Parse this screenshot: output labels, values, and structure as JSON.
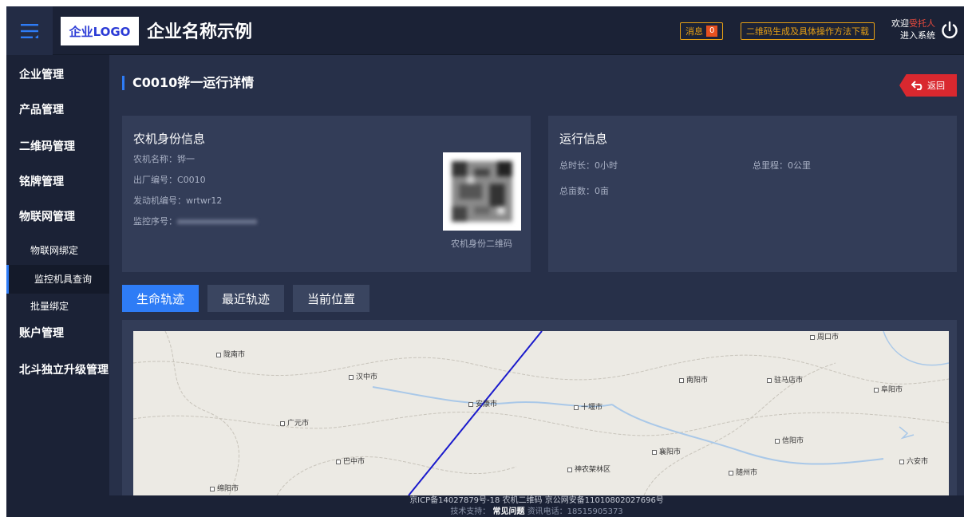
{
  "header": {
    "logo_text": "企业LOGO",
    "company_name": "企业名称示例",
    "messages_label": "消息",
    "messages_count": "0",
    "qr_download_label": "二维码生成及具体操作方法下载",
    "welcome_prefix": "欢迎",
    "welcome_user": "受托人",
    "welcome_suffix": "进入系统"
  },
  "sidebar": {
    "items": [
      {
        "label": "企业管理"
      },
      {
        "label": "产品管理"
      },
      {
        "label": "二维码管理"
      },
      {
        "label": "铭牌管理"
      },
      {
        "label": "物联网管理"
      },
      {
        "label": "账户管理"
      },
      {
        "label": "北斗独立升级管理"
      }
    ],
    "sub_items": [
      {
        "label": "物联网绑定"
      },
      {
        "label": "监控机具查询"
      },
      {
        "label": "批量绑定"
      }
    ]
  },
  "page": {
    "title": "C0010铧一运行详情",
    "back_label": "返回"
  },
  "identity_card": {
    "title": "农机身份信息",
    "name": "农机名称：铧一",
    "factory_no": "出厂编号：C0010",
    "engine_no": "发动机编号：wrtwr12",
    "monitor_label": "监控序号：",
    "qr_caption": "农机身份二维码"
  },
  "run_card": {
    "title": "运行信息",
    "total_duration": "总时长：0小时",
    "total_mileage": "总里程：0公里",
    "total_area": "总亩数：0亩"
  },
  "tabs": [
    {
      "label": "生命轨迹"
    },
    {
      "label": "最近轨迹"
    },
    {
      "label": "当前位置"
    }
  ],
  "map": {
    "cities": [
      "周口市",
      "陇南市",
      "汉中市",
      "南阳市",
      "驻马店市",
      "阜阳市",
      "安康市",
      "十堰市",
      "广元市",
      "信阳市",
      "襄阳市",
      "巴中市",
      "神农架林区",
      "随州市",
      "六安市",
      "绵阳市"
    ],
    "track_color": "#1a1acc"
  },
  "footer": {
    "line1": "京ICP备14027879号-18 农机二维码 京公网安备11010802027696号",
    "line2_a": "技术支持：",
    "line2_b": "常见问题",
    "line2_c": "资讯电话：18515905373"
  },
  "colors": {
    "accent": "#2e7cf6",
    "header_bg": "#1b2236",
    "panel_bg": "#333d58",
    "warning": "#e6a015",
    "danger": "#d9282f"
  }
}
